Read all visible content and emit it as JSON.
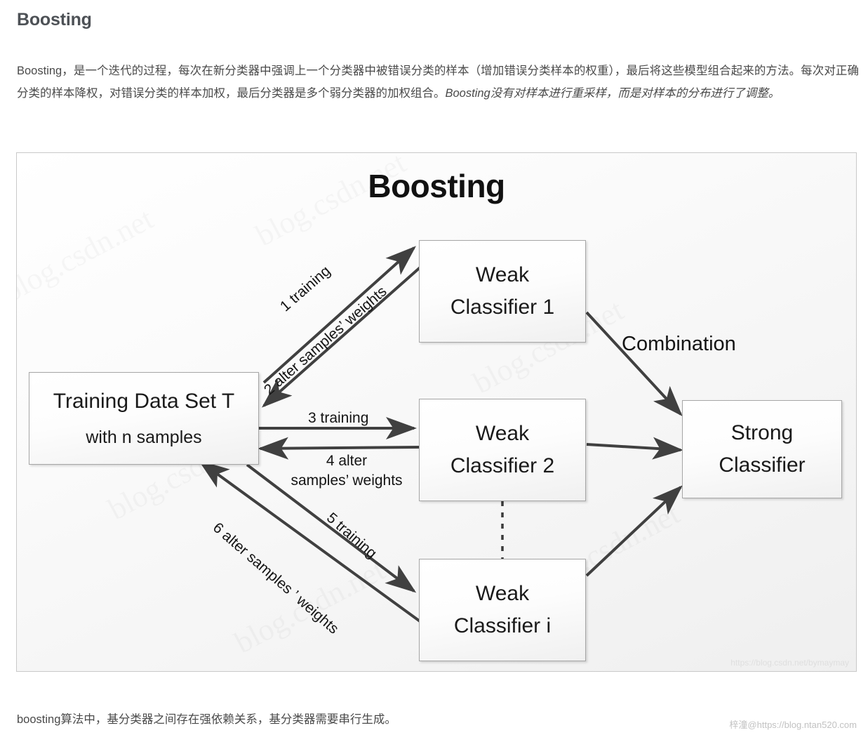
{
  "article": {
    "heading": "Boosting",
    "paragraph_part1": "Boosting，是一个迭代的过程，每次在新分类器中强调上一个分类器中被错误分类的样本（增加错误分类样本的权重），最后将这些模型组合起来的方法。每次对正确分类的样本降权，对错误分类的样本加权，最后分类器是多个弱分类器的加权组合。",
    "paragraph_emphasis": "Boosting没有对样本进行重采样，而是对样本的分布进行了调整。",
    "footer_note": "boosting算法中，基分类器之间存在强依赖关系，基分类器需要串行生成。",
    "footer_watermark": "梓潼@https://blog.ntan520.com"
  },
  "figure": {
    "title": "Boosting",
    "credit_watermark": "https://blog.csdn.net/bymaymay",
    "watermark_text": "blog.csdn.net",
    "nodes": {
      "training_set": {
        "line1": "Training Data Set T",
        "line2": "with n samples"
      },
      "weak_1": {
        "line1": "Weak",
        "line2": "Classifier 1"
      },
      "weak_2": {
        "line1": "Weak",
        "line2": "Classifier 2"
      },
      "weak_i": {
        "line1": "Weak",
        "line2": "Classifier i"
      },
      "strong": {
        "line1": "Strong",
        "line2": "Classifier"
      }
    },
    "edge_labels": {
      "e1": "1 training",
      "e2": "2 alter samples’ weights",
      "e3": "3 training",
      "e4_line1": "4 alter",
      "e4_line2": "samples’ weights",
      "e5": "5 training",
      "e6": "6 alter samples ’ weights",
      "combination": "Combination"
    },
    "colors": {
      "line": "#404040",
      "node_border": "#a6a6a6",
      "frame_border": "#c9c9c9",
      "heading": "#4d5156",
      "body_text": "#4a4a4a"
    }
  }
}
